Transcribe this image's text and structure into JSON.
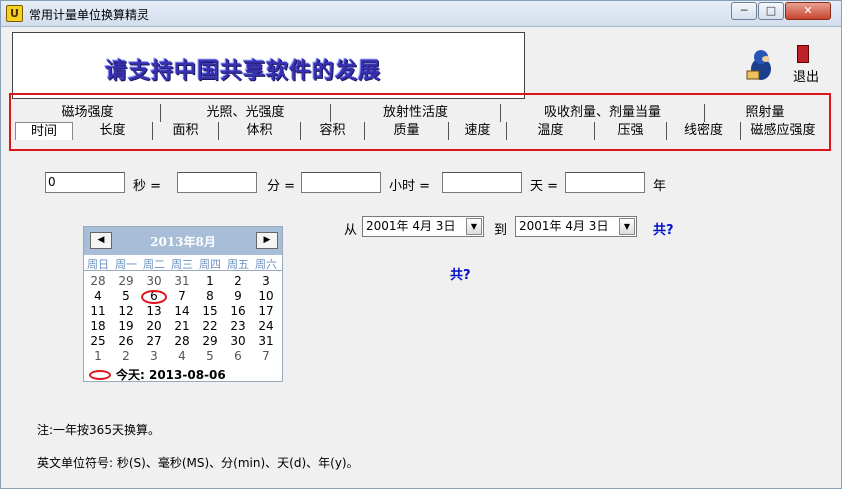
{
  "window": {
    "title": "常用计量单位换算精灵",
    "app_icon": "app-logo-icon",
    "min_glyph": "─",
    "max_glyph": "□",
    "close_glyph": "✕"
  },
  "banner": {
    "text": "请支持中国共享软件的发展"
  },
  "exit": {
    "label": "退出",
    "icon": "exit-door-icon"
  },
  "tabs": {
    "row1": [
      "磁场强度",
      "光照、光强度",
      "放射性活度",
      "吸收剂量、剂量当量",
      "照射量"
    ],
    "row2": [
      "时间",
      "长度",
      "面积",
      "体积",
      "容积",
      "质量",
      "速度",
      "温度",
      "压强",
      "线密度",
      "磁感应强度"
    ],
    "active": "时间"
  },
  "converter": {
    "seconds_value": "0",
    "seconds_label": "秒 =",
    "minutes_value": "",
    "minutes_label": "分 =",
    "hours_value": "",
    "hours_label": "小时 =",
    "days_value": "",
    "days_label": "天 =",
    "years_value": "",
    "years_label": "年"
  },
  "date_range": {
    "from_label": "从",
    "from_value": "2001年 4月 3日",
    "to_label": "到",
    "to_value": "2001年 4月 3日",
    "total_label_1": "共?",
    "total_label_2": "共?"
  },
  "calendar": {
    "title": "2013年8月",
    "prev_glyph": "◀",
    "next_glyph": "▶",
    "weekdays": [
      "周日",
      "周一",
      "周二",
      "周三",
      "周四",
      "周五",
      "周六"
    ],
    "weeks": [
      [
        "28",
        "29",
        "30",
        "31",
        "1",
        "2",
        "3"
      ],
      [
        "4",
        "5",
        "6",
        "7",
        "8",
        "9",
        "10"
      ],
      [
        "11",
        "12",
        "13",
        "14",
        "15",
        "16",
        "17"
      ],
      [
        "18",
        "19",
        "20",
        "21",
        "22",
        "23",
        "24"
      ],
      [
        "25",
        "26",
        "27",
        "28",
        "29",
        "30",
        "31"
      ],
      [
        "1",
        "2",
        "3",
        "4",
        "5",
        "6",
        "7"
      ]
    ],
    "today_text": "今天: 2013-08-06"
  },
  "notes": {
    "line1": "注:一年按365天换算。",
    "line2": "英文单位符号: 秒(S)、毫秒(MS)、分(min)、天(d)、年(y)。"
  }
}
